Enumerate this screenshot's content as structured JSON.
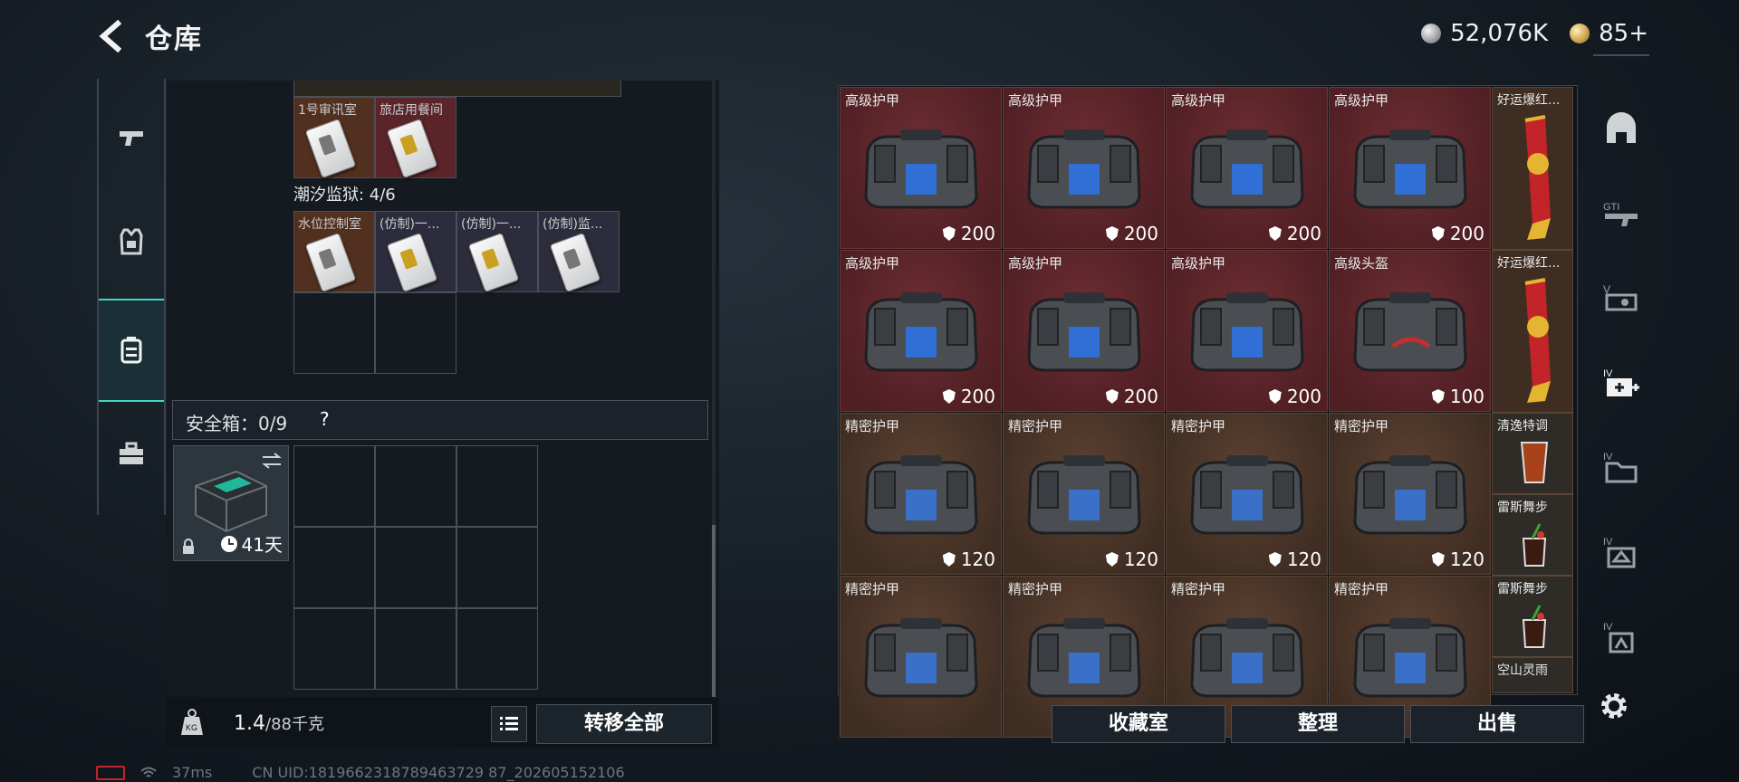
{
  "header": {
    "back_icon": "back-arrow-icon",
    "title": "仓库"
  },
  "currency": {
    "silver": "52,076K",
    "gold": "85+"
  },
  "left_tabs": [
    {
      "name": "weapons",
      "icon": "pistol-icon"
    },
    {
      "name": "equipment",
      "icon": "vest-icon"
    },
    {
      "name": "backpack",
      "icon": "backpack-icon"
    },
    {
      "name": "toolbox",
      "icon": "toolbox-icon"
    }
  ],
  "inventory": {
    "top_cards": [
      {
        "label": "1号审讯室",
        "color": "brown"
      },
      {
        "label": "旅店用餐间",
        "color": "red"
      }
    ],
    "prison_label": "潮汐监狱: 4/6",
    "prison_cards": [
      {
        "label": "水位控制室",
        "color": "brown"
      },
      {
        "label": "(仿制)一...",
        "color": "purple",
        "gold": true
      },
      {
        "label": "(仿制)一...",
        "color": "purple",
        "gold": true
      },
      {
        "label": "(仿制)监...",
        "color": "purple"
      }
    ],
    "safe_label": "安全箱：0/9",
    "safe_help": "?",
    "case_days": "41天"
  },
  "weight": {
    "current": "1.4",
    "unit": "/88千克"
  },
  "buttons": {
    "transfer_all": "转移全部",
    "collection": "收藏室",
    "sort": "整理",
    "sell": "出售"
  },
  "status": {
    "ping": "37ms",
    "uid": "CN UID:1819662318789463729 87_202605152106"
  },
  "warehouse": {
    "rows": [
      [
        {
          "label": "高级护甲",
          "value": "200",
          "bg": "red",
          "armor": "blue"
        },
        {
          "label": "高级护甲",
          "value": "200",
          "bg": "red",
          "armor": "blue"
        },
        {
          "label": "高级护甲",
          "value": "200",
          "bg": "red",
          "armor": "blue"
        },
        {
          "label": "高级护甲",
          "value": "200",
          "bg": "red",
          "armor": "blue"
        }
      ],
      [
        {
          "label": "高级护甲",
          "value": "200",
          "bg": "red",
          "armor": "blue"
        },
        {
          "label": "高级护甲",
          "value": "200",
          "bg": "red",
          "armor": "blue"
        },
        {
          "label": "高级护甲",
          "value": "200",
          "bg": "red",
          "armor": "blue"
        },
        {
          "label": "高级头盔",
          "value": "100",
          "bg": "red",
          "armor": "red"
        }
      ],
      [
        {
          "label": "精密护甲",
          "value": "120",
          "bg": "brown",
          "armor": "grey"
        },
        {
          "label": "精密护甲",
          "value": "120",
          "bg": "brown",
          "armor": "grey"
        },
        {
          "label": "精密护甲",
          "value": "120",
          "bg": "brown",
          "armor": "grey"
        },
        {
          "label": "精密护甲",
          "value": "120",
          "bg": "brown",
          "armor": "grey"
        }
      ],
      [
        {
          "label": "精密护甲",
          "value": "",
          "bg": "brown",
          "armor": "grey"
        },
        {
          "label": "精密护甲",
          "value": "",
          "bg": "brown",
          "armor": "grey"
        },
        {
          "label": "精密护甲",
          "value": "",
          "bg": "brown",
          "armor": "grey"
        },
        {
          "label": "精密护甲",
          "value": "",
          "bg": "brown",
          "armor": "grey"
        }
      ]
    ],
    "side_items": [
      {
        "label": "好运爆红..."
      },
      {
        "label": "好运爆红..."
      },
      {
        "label": "清逸特调"
      },
      {
        "label": "雷斯舞步"
      },
      {
        "label": "雷斯舞步"
      },
      {
        "label": "空山灵雨"
      }
    ]
  },
  "right_icons": [
    "helmet-icon",
    "gti-rifle-icon",
    "v-scope-icon",
    "iv-medkit-icon",
    "iv-folder-icon",
    "iv-armor-icon",
    "iv-shield-icon"
  ],
  "colors": {
    "accent": "#3fd6c2",
    "red_rarity": "#5a2428",
    "gold_rarity": "#4a3426"
  }
}
